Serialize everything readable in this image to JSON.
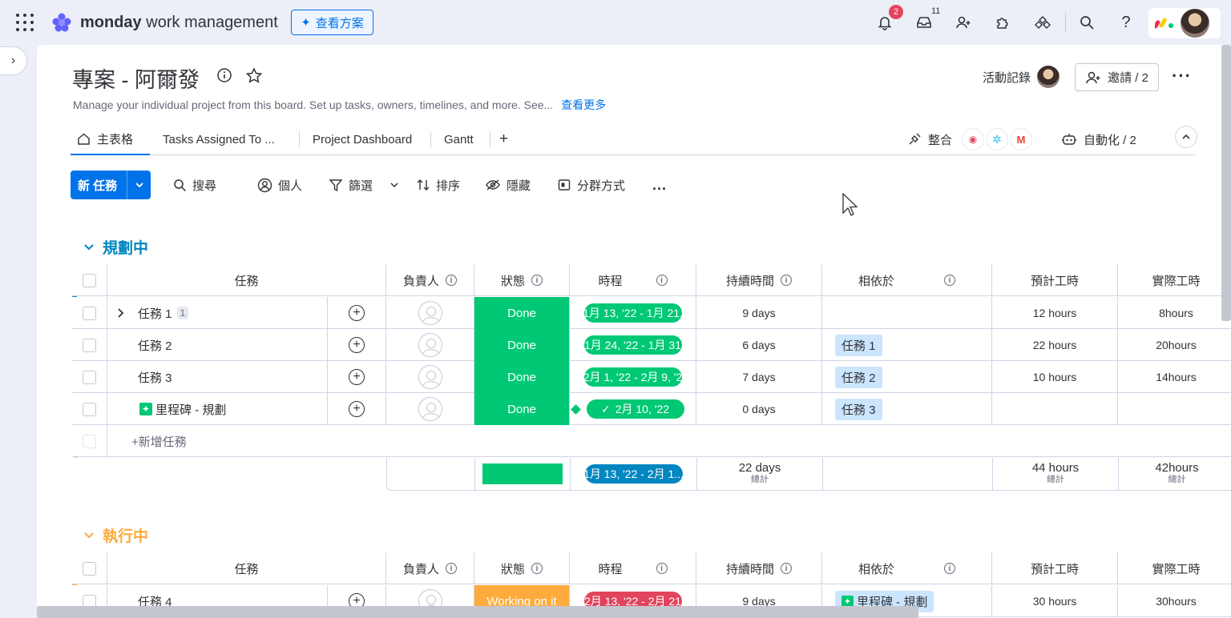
{
  "app": {
    "brand": "monday",
    "product": "work management",
    "plans_button": "查看方案"
  },
  "topbar": {
    "notifications_badge": "2",
    "inbox_badge": "11"
  },
  "board": {
    "title": "專案 - 阿爾發",
    "description": "Manage your individual project from this board. Set up tasks, owners, timelines, and more. See...",
    "see_more": "查看更多",
    "activity_label": "活動記錄",
    "invite_label": "邀請 / 2"
  },
  "tabs": [
    {
      "label": "主表格"
    },
    {
      "label": "Tasks Assigned To ..."
    },
    {
      "label": "Project Dashboard"
    },
    {
      "label": "Gantt"
    }
  ],
  "tab_add": "+",
  "integrations_label": "整合",
  "automations_label": "自動化 / 2",
  "toolbar": {
    "new_task": "新 任務",
    "search": "搜尋",
    "person": "個人",
    "filter": "篩選",
    "sort": "排序",
    "hide": "隱藏",
    "group_by": "分群方式",
    "more": "..."
  },
  "columns": [
    "任務",
    "負責人",
    "狀態",
    "時程",
    "持續時間",
    "相依於",
    "預計工時",
    "實際工時"
  ],
  "groups": [
    {
      "name": "規劃中",
      "color": "#0086c0",
      "rows": [
        {
          "task": "任務 1",
          "subitems": "1",
          "status": "Done",
          "timeline": "1月 13, '22 - 1月 21,",
          "duration": "9 days",
          "depends": "",
          "est": "12 hours",
          "actual": "8hours"
        },
        {
          "task": "任務 2",
          "status": "Done",
          "timeline": "1月 24, '22 - 1月 31",
          "duration": "6 days",
          "depends": "任務 1",
          "est": "22 hours",
          "actual": "20hours"
        },
        {
          "task": "任務 3",
          "status": "Done",
          "timeline": "2月 1, '22 - 2月 9, '2",
          "duration": "7 days",
          "depends": "任務 2",
          "est": "10 hours",
          "actual": "14hours"
        },
        {
          "task": "里程碑 - 規劃",
          "milestone": true,
          "status": "Done",
          "timeline": "2月 10, '22",
          "duration": "0 days",
          "depends": "任務 3",
          "est": "",
          "actual": ""
        }
      ],
      "add_task": "+新增任務",
      "summary": {
        "timeline": "1月 13, '22 - 2月 1...",
        "duration": "22 days",
        "est": "44 hours",
        "actual": "42hours",
        "total_label": "總計"
      }
    },
    {
      "name": "執行中",
      "color": "#fdab3d",
      "rows": [
        {
          "task": "任務 4",
          "status": "Working on it",
          "timeline": "2月 13, '22 - 2月 21",
          "duration": "9 days",
          "depends": "里程碑 - 規劃",
          "est": "30 hours",
          "actual": "30hours"
        }
      ]
    }
  ],
  "colors": {
    "primary": "#0073ea",
    "done": "#00c875",
    "working": "#fdab3d",
    "stuck": "#e2445c",
    "timeline_blue": "#0086c0"
  }
}
